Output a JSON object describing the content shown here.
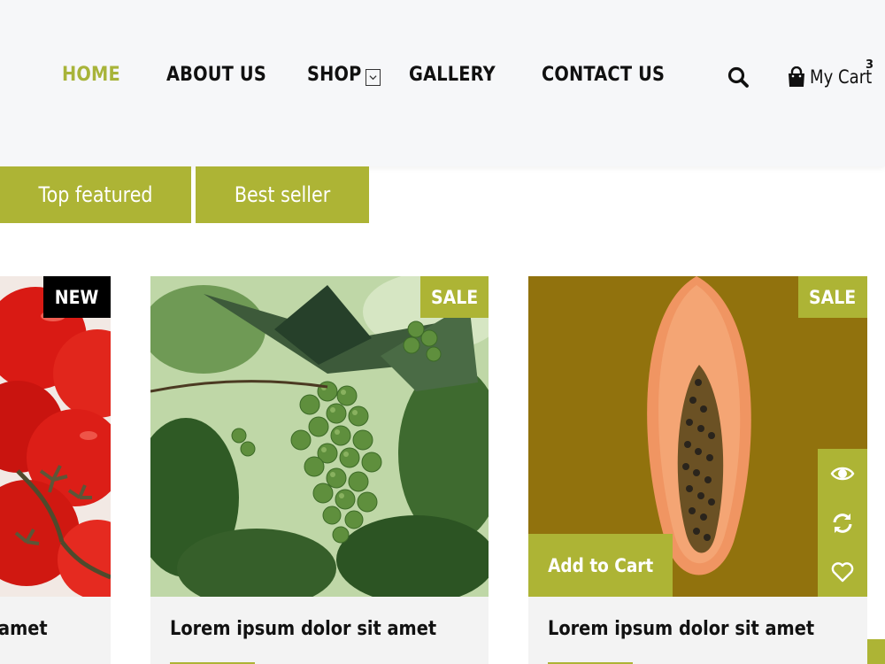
{
  "nav": {
    "items": [
      {
        "label": "HOME",
        "active": true
      },
      {
        "label": "ABOUT US",
        "active": false
      },
      {
        "label": "SHOP",
        "active": false
      },
      {
        "label": "GALLERY",
        "active": false
      },
      {
        "label": "CONTACT US",
        "active": false
      }
    ],
    "search_icon": "search-icon",
    "cart": {
      "label": "My Cart",
      "count": "3",
      "icon": "shopping-bag-icon"
    }
  },
  "tabs": [
    {
      "label": "Top featured"
    },
    {
      "label": "Best seller"
    }
  ],
  "products": [
    {
      "title": "amet",
      "badge": "NEW",
      "image": "tomatoes"
    },
    {
      "title": "Lorem ipsum dolor sit amet",
      "badge": "SALE",
      "image": "grapes"
    },
    {
      "title": "Lorem ipsum dolor sit amet",
      "badge": "SALE",
      "image": "papaya",
      "add_to_cart": "Add to Cart",
      "actions": [
        "eye-icon",
        "refresh-icon",
        "heart-icon"
      ]
    }
  ],
  "colors": {
    "accent": "#adb435",
    "active_nav": "#a8b43a",
    "header_bg": "#f6f7f9",
    "badge_new": "#000000"
  }
}
